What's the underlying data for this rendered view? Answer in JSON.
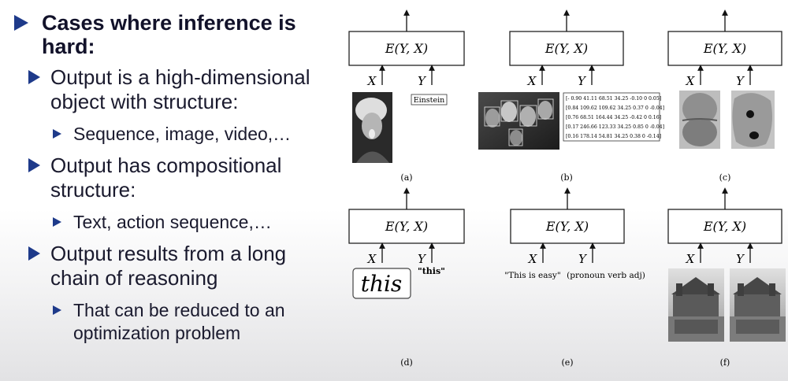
{
  "bullets": {
    "title": [
      "Cases where inference is",
      "hard:"
    ],
    "items": [
      {
        "lines": [
          "Output is a high-dimensional",
          "object with structure:"
        ],
        "sub": [
          "Sequence, image, video,…"
        ]
      },
      {
        "lines": [
          "Output has compositional",
          "structure:"
        ],
        "sub": [
          "Text, action sequence,…"
        ]
      },
      {
        "lines": [
          "Output results from a long",
          "chain of reasoning"
        ],
        "sub": [
          "That can be reduced to an",
          "optimization problem"
        ]
      }
    ]
  },
  "figure": {
    "energy_label": "E(Y, X)",
    "x_label": "X",
    "y_label": "Y",
    "panels": [
      "(a)",
      "(b)",
      "(c)",
      "(d)",
      "(e)",
      "(f)"
    ],
    "a_text": "Einstein",
    "b_matrix": [
      "[- 0.90 41.11 68.51 34.25 -0.10 0 0.05]",
      "[0.84 109.62 109.62 34.25 0.37 0 -0.04]",
      "[0.76 68.51 164.44 34.25 -0.42 0 0.16]",
      "[0.17 246.66 123.33 34.25 0.85 0 -0.04]",
      "[0.16 178.14 54.81 34.25 0.38 0 -0.14]"
    ],
    "d_handwriting": "this",
    "d_text": "\"this\"",
    "e_x_text": "\"This is easy\"",
    "e_y_text": "(pronoun verb adj)"
  }
}
